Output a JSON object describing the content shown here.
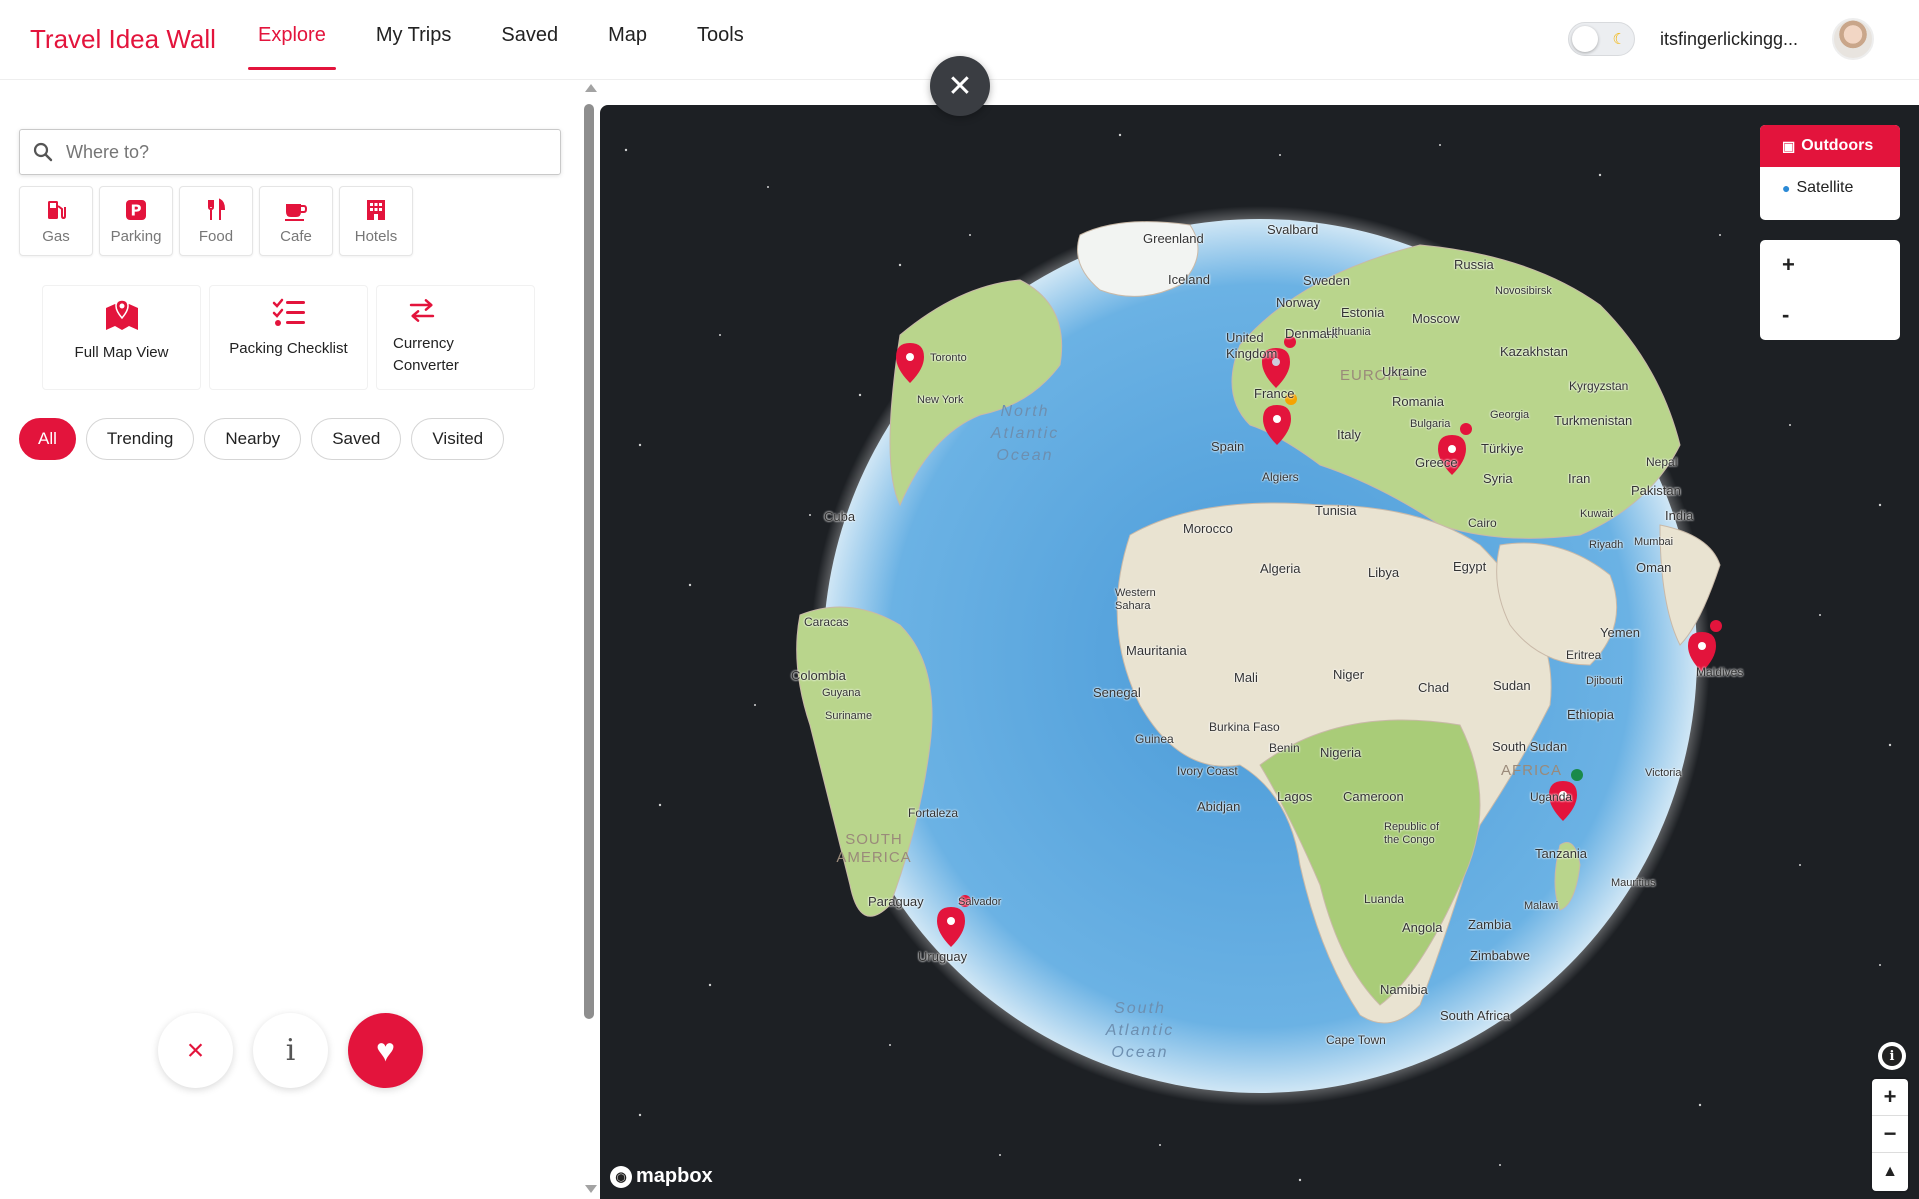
{
  "header": {
    "brand": "Travel Idea Wall",
    "nav": [
      {
        "label": "Explore",
        "active": true
      },
      {
        "label": "My Trips",
        "active": false
      },
      {
        "label": "Saved",
        "active": false
      },
      {
        "label": "Map",
        "active": false
      },
      {
        "label": "Tools",
        "active": false
      }
    ],
    "username": "itsfingerlickingg...",
    "theme_toggle_icon": "moon-icon"
  },
  "close_button": {
    "icon": "close-icon"
  },
  "sidebar": {
    "search": {
      "placeholder": "Where to?",
      "value": ""
    },
    "quick_filters": [
      {
        "label": "Gas",
        "icon": "gas-pump-icon"
      },
      {
        "label": "Parking",
        "icon": "parking-icon"
      },
      {
        "label": "Food",
        "icon": "utensils-icon"
      },
      {
        "label": "Cafe",
        "icon": "coffee-cup-icon"
      },
      {
        "label": "Hotels",
        "icon": "hotel-icon"
      }
    ],
    "tools": [
      {
        "label": "Full Map View",
        "icon": "map-pin-icon"
      },
      {
        "label": "Packing Checklist",
        "icon": "checklist-icon"
      },
      {
        "label": "Currency Converter",
        "icon": "exchange-arrows-icon"
      }
    ],
    "filters": [
      {
        "label": "All",
        "active": true
      },
      {
        "label": "Trending",
        "active": false
      },
      {
        "label": "Nearby",
        "active": false
      },
      {
        "label": "Saved",
        "active": false
      },
      {
        "label": "Visited",
        "active": false
      }
    ],
    "actions": [
      {
        "icon": "close-icon",
        "label": "×"
      },
      {
        "icon": "info-icon",
        "label": "i"
      },
      {
        "icon": "heart-icon",
        "label": "♥"
      }
    ]
  },
  "map": {
    "style_options": [
      {
        "label": "Outdoors",
        "active": true
      },
      {
        "label": "Satellite",
        "active": false
      }
    ],
    "zoom_in_label": "+",
    "zoom_out_label": "-",
    "attribution_logo": "mapbox",
    "nav_controls": [
      "+",
      "−",
      "▲"
    ],
    "labels": {
      "greenland": "Greenland",
      "svalbard": "Svalbard",
      "iceland": "Iceland",
      "russia": "Russia",
      "norway": "Norway",
      "sweden": "Sweden",
      "estonia": "Estonia",
      "novosibirsk": "Novosibirsk",
      "uk": "United Kingdom",
      "denmark": "Denmark",
      "lithuania": "Lithuania",
      "moscow": "Moscow",
      "kazakhstan": "Kazakhstan",
      "europe": "EUROPE",
      "ukraine": "Ukraine",
      "france": "France",
      "kyrgyzstan": "Kyrgyzstan",
      "romania": "Romania",
      "georgia": "Georgia",
      "turkmenistan": "Turkmenistan",
      "bulgaria": "Bulgaria",
      "toronto": "Toronto",
      "newyork": "New York",
      "spain": "Spain",
      "italy": "Italy",
      "turkiye": "Türkiye",
      "nepal": "Nepal",
      "greece": "Greece",
      "syria": "Syria",
      "iran": "Iran",
      "pakistan": "Pakistan",
      "algiers": "Algiers",
      "tunisia": "Tunisia",
      "kuwait": "Kuwait",
      "india": "India",
      "cuba": "Cuba",
      "morocco": "Morocco",
      "cairo": "Cairo",
      "riyadh": "Riyadh",
      "mumbai": "Mumbai",
      "algeria": "Algeria",
      "libya": "Libya",
      "egypt": "Egypt",
      "oman": "Oman",
      "westernsahara": "Western Sahara",
      "caracas": "Caracas",
      "yemen": "Yemen",
      "eritrea": "Eritrea",
      "maldives": "Maldives",
      "mauritania": "Mauritania",
      "colombia": "Colombia",
      "mali": "Mali",
      "niger": "Niger",
      "chad": "Chad",
      "sudan": "Sudan",
      "djibouti": "Djibouti",
      "guyana": "Guyana",
      "senegal": "Senegal",
      "suriname": "Suriname",
      "ethiopia": "Ethiopia",
      "burkinafaso": "Burkina Faso",
      "guinea": "Guinea",
      "benin": "Benin",
      "nigeria": "Nigeria",
      "southsudan": "South Sudan",
      "ivorycoast": "Ivory Coast",
      "africa": "AFRICA",
      "victoria": "Victoria",
      "abidjan": "Abidjan",
      "lagos": "Lagos",
      "cameroon": "Cameroon",
      "uganda": "Uganda",
      "fortaleza": "Fortaleza",
      "southamerica": "SOUTH AMERICA",
      "congo": "Republic of the Congo",
      "tanzania": "Tanzania",
      "mauritius": "Mauritius",
      "luanda": "Luanda",
      "malawi": "Malawi",
      "paraguay": "Paraguay",
      "salvador": "Salvador",
      "angola": "Angola",
      "zambia": "Zambia",
      "uruguay": "Uruguay",
      "zimbabwe": "Zimbabwe",
      "namibia": "Namibia",
      "southafrica": "South Africa",
      "capetown": "Cape Town",
      "northatlantic": "North Atlantic Ocean",
      "southatlantic": "South Atlantic Ocean"
    },
    "pins": [
      {
        "place": "New York"
      },
      {
        "place": "United Kingdom"
      },
      {
        "place": "Spain"
      },
      {
        "place": "Greece"
      },
      {
        "place": "Maldives"
      },
      {
        "place": "Uganda"
      },
      {
        "place": "Salvador"
      }
    ]
  },
  "colors": {
    "accent": "#e3143c",
    "map_bg": "#1d2024",
    "ocean": "#5fa9e0",
    "land": "#e8e1cf",
    "green": "#a9cc78"
  }
}
